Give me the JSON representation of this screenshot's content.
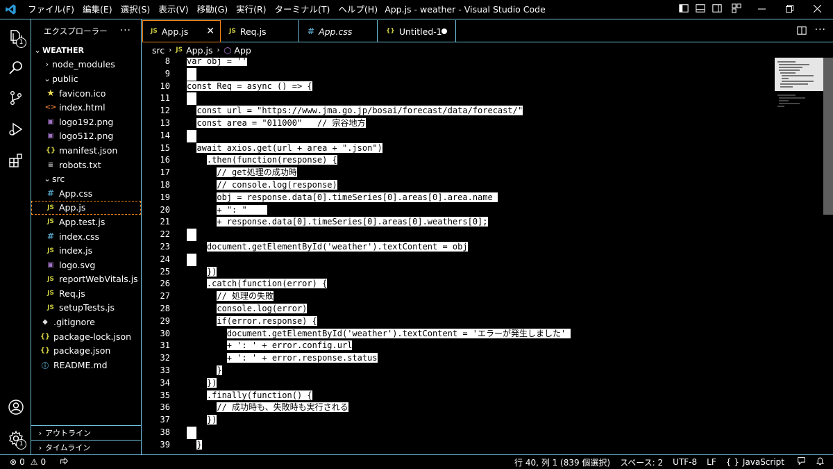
{
  "titlebar": {
    "menu": [
      "ファイル(F)",
      "編集(E)",
      "選択(S)",
      "表示(V)",
      "移動(G)",
      "実行(R)",
      "ターミナル(T)",
      "ヘルプ(H)"
    ],
    "title": "App.js - weather - Visual Studio Code"
  },
  "activity": {
    "explorer_badge": "1",
    "settings_badge": "1"
  },
  "sidebar": {
    "header": "エクスプローラー",
    "more": "···",
    "root": "WEATHER",
    "items": [
      {
        "label": "node_modules",
        "kind": "folder-closed"
      },
      {
        "label": "public",
        "kind": "folder-open"
      },
      {
        "label": "favicon.ico",
        "kind": "star-icon"
      },
      {
        "label": "index.html",
        "kind": "html-icon"
      },
      {
        "label": "logo192.png",
        "kind": "image-icon"
      },
      {
        "label": "logo512.png",
        "kind": "image-icon"
      },
      {
        "label": "manifest.json",
        "kind": "json-icon"
      },
      {
        "label": "robots.txt",
        "kind": "text-icon"
      },
      {
        "label": "src",
        "kind": "folder-open"
      },
      {
        "label": "App.css",
        "kind": "css-icon"
      },
      {
        "label": "App.js",
        "kind": "js-icon"
      },
      {
        "label": "App.test.js",
        "kind": "js-icon"
      },
      {
        "label": "index.css",
        "kind": "css-icon"
      },
      {
        "label": "index.js",
        "kind": "js-icon"
      },
      {
        "label": "logo.svg",
        "kind": "image-icon"
      },
      {
        "label": "reportWebVitals.js",
        "kind": "js-icon"
      },
      {
        "label": "Req.js",
        "kind": "js-icon"
      },
      {
        "label": "setupTests.js",
        "kind": "js-icon"
      },
      {
        "label": ".gitignore",
        "kind": "git-icon"
      },
      {
        "label": "package-lock.json",
        "kind": "json-icon"
      },
      {
        "label": "package.json",
        "kind": "json-icon"
      },
      {
        "label": "README.md",
        "kind": "info-icon"
      }
    ],
    "outline": "アウトライン",
    "timeline": "タイムライン"
  },
  "tabs": [
    {
      "label": "App.js",
      "icon": "JS"
    },
    {
      "label": "Req.js",
      "icon": "JS"
    },
    {
      "label": "App.css",
      "icon": "#"
    },
    {
      "label": "Untitled-1",
      "icon": "{}"
    }
  ],
  "breadcrumb": {
    "folder": "src",
    "file": "App.js",
    "symbol": "App"
  },
  "editor": {
    "lines": [
      {
        "n": "8",
        "pre": "",
        "text": "var obj = ''"
      },
      {
        "n": "9",
        "pre": "",
        "text": ""
      },
      {
        "n": "10",
        "pre": "",
        "text": "const Req = async () => {"
      },
      {
        "n": "11",
        "pre": "",
        "text": ""
      },
      {
        "n": "12",
        "pre": "  ",
        "text": "const url = \"https://www.jma.go.jp/bosai/forecast/data/forecast/\""
      },
      {
        "n": "13",
        "pre": "  ",
        "text": "const area = \"011000\"   // 宗谷地方"
      },
      {
        "n": "14",
        "pre": "",
        "text": ""
      },
      {
        "n": "15",
        "pre": "  ",
        "text": "await axios.get(url + area + \".json\")"
      },
      {
        "n": "16",
        "pre": "    ",
        "text": ".then(function(response) {"
      },
      {
        "n": "17",
        "pre": "      ",
        "text": "// get処理の成功時"
      },
      {
        "n": "18",
        "pre": "      ",
        "text": "// console.log(response)"
      },
      {
        "n": "19",
        "pre": "      ",
        "text": "obj = response.data[0].timeSeries[0].areas[0].area.name "
      },
      {
        "n": "20",
        "pre": "      ",
        "text": "+ \": \"    "
      },
      {
        "n": "21",
        "pre": "      ",
        "text": "+ response.data[0].timeSeries[0].areas[0].weathers[0];"
      },
      {
        "n": "22",
        "pre": "",
        "text": ""
      },
      {
        "n": "23",
        "pre": "    ",
        "text": "document.getElementById('weather').textContent = obj"
      },
      {
        "n": "24",
        "pre": "",
        "text": ""
      },
      {
        "n": "25",
        "pre": "    ",
        "text": "})"
      },
      {
        "n": "26",
        "pre": "    ",
        "text": ".catch(function(error) {"
      },
      {
        "n": "27",
        "pre": "      ",
        "text": "// 処理の失敗"
      },
      {
        "n": "28",
        "pre": "      ",
        "text": "console.log(error)"
      },
      {
        "n": "29",
        "pre": "      ",
        "text": "if(error.response) {"
      },
      {
        "n": "30",
        "pre": "        ",
        "text": "document.getElementById('weather').textContent = 'エラーが発生しました' "
      },
      {
        "n": "31",
        "pre": "        ",
        "text": "+ ': ' + error.config.url"
      },
      {
        "n": "32",
        "pre": "        ",
        "text": "+ ': ' + error.response.status"
      },
      {
        "n": "33",
        "pre": "      ",
        "text": "}"
      },
      {
        "n": "34",
        "pre": "    ",
        "text": "})"
      },
      {
        "n": "35",
        "pre": "    ",
        "text": ".finally(function() {"
      },
      {
        "n": "36",
        "pre": "      ",
        "text": "// 成功時も、失敗時も実行される"
      },
      {
        "n": "37",
        "pre": "    ",
        "text": "})"
      },
      {
        "n": "38",
        "pre": "",
        "text": ""
      },
      {
        "n": "39",
        "pre": "  ",
        "text": "}"
      }
    ]
  },
  "statusbar": {
    "errors": "0",
    "warnings": "0",
    "position": "行 40, 列 1 (839 個選択)",
    "spaces": "スペース: 2",
    "encoding": "UTF-8",
    "eol": "LF",
    "language": "JavaScript"
  }
}
